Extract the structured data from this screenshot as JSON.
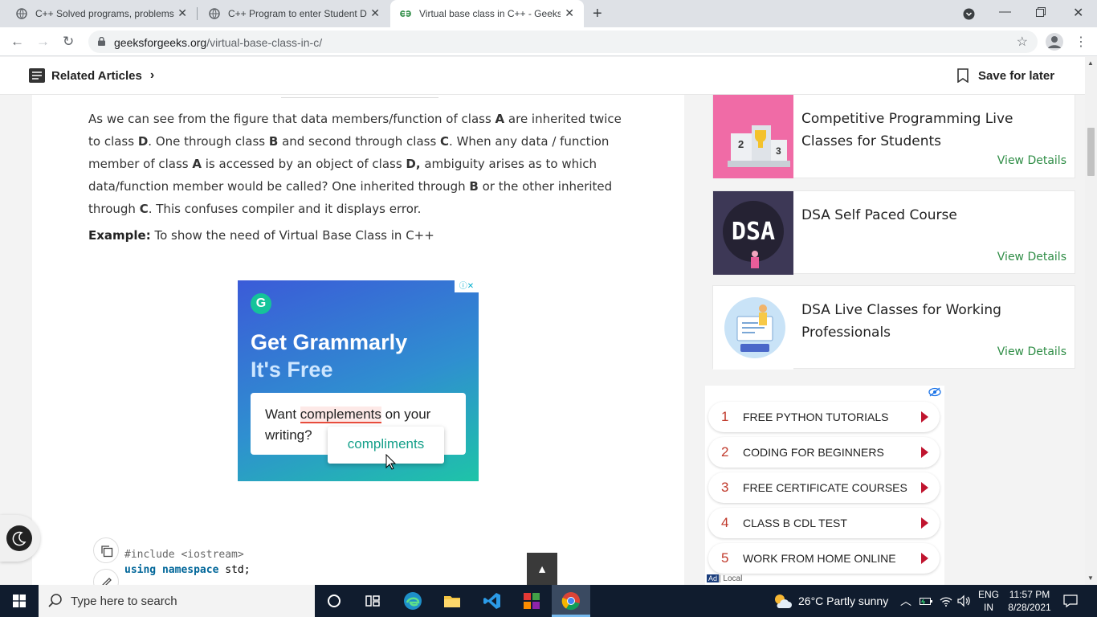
{
  "browser": {
    "tabs": [
      {
        "title": "C++ Solved programs, problems"
      },
      {
        "title": "C++ Program to enter Student D"
      },
      {
        "title": "Virtual base class in C++ - Geeks"
      }
    ],
    "url_domain": "geeksforgeeks.org",
    "url_path": "/virtual-base-class-in-c/"
  },
  "header": {
    "related_label": "Related Articles",
    "save_label": "Save for later"
  },
  "article": {
    "para_parts": [
      "As we can see from the figure that data members/function of class ",
      "A",
      " are inherited twice to class ",
      "D",
      ". One through class ",
      "B",
      " and second through class ",
      "C",
      ". When any data / function member of class ",
      "A",
      " is accessed by an object of class ",
      "D,",
      " ambiguity arises as to which data/function member would be called? One inherited through ",
      "B",
      " or the other inherited through ",
      "C",
      ". This confuses compiler and it displays error."
    ],
    "example_label": "Example:",
    "example_text": " To show the need of Virtual Base Class in C++",
    "code": {
      "line1": "#include <iostream>",
      "line2_kw1": "using",
      "line2_kw2": "namespace",
      "line2_rest": "std;"
    }
  },
  "ad": {
    "logo_letter": "G",
    "headline1": "Get Grammarly",
    "headline2": "It's Free",
    "card_pre": "Want ",
    "card_highlight": "complements",
    "card_post": " on your writing?",
    "suggestion": "compliments",
    "choices": "ⓘ✕"
  },
  "sidebar": {
    "courses": [
      {
        "title": "Competitive Programming Live Classes for Students",
        "link": "View Details"
      },
      {
        "title": "DSA Self Paced Course",
        "link": "View Details",
        "thumb_text": "DSA"
      },
      {
        "title": "DSA Live Classes for Working Professionals",
        "link": "View Details"
      }
    ],
    "ad_list": [
      {
        "num": "1",
        "label": "FREE PYTHON TUTORIALS"
      },
      {
        "num": "2",
        "label": "CODING FOR BEGINNERS"
      },
      {
        "num": "3",
        "label": "FREE CERTIFICATE COURSES"
      },
      {
        "num": "4",
        "label": "CLASS B CDL TEST"
      },
      {
        "num": "5",
        "label": "WORK FROM HOME ONLINE"
      }
    ],
    "ad_tag": "Ad",
    "ad_local": "| Local"
  },
  "back_top": "▲",
  "taskbar": {
    "search_placeholder": "Type here to search",
    "weather": "26°C  Partly sunny",
    "lang1": "ENG",
    "lang2": "IN",
    "time": "11:57 PM",
    "date": "8/28/2021"
  },
  "colors": {
    "gfg_green": "#2f8d46",
    "taskbar": "#101c2e"
  }
}
